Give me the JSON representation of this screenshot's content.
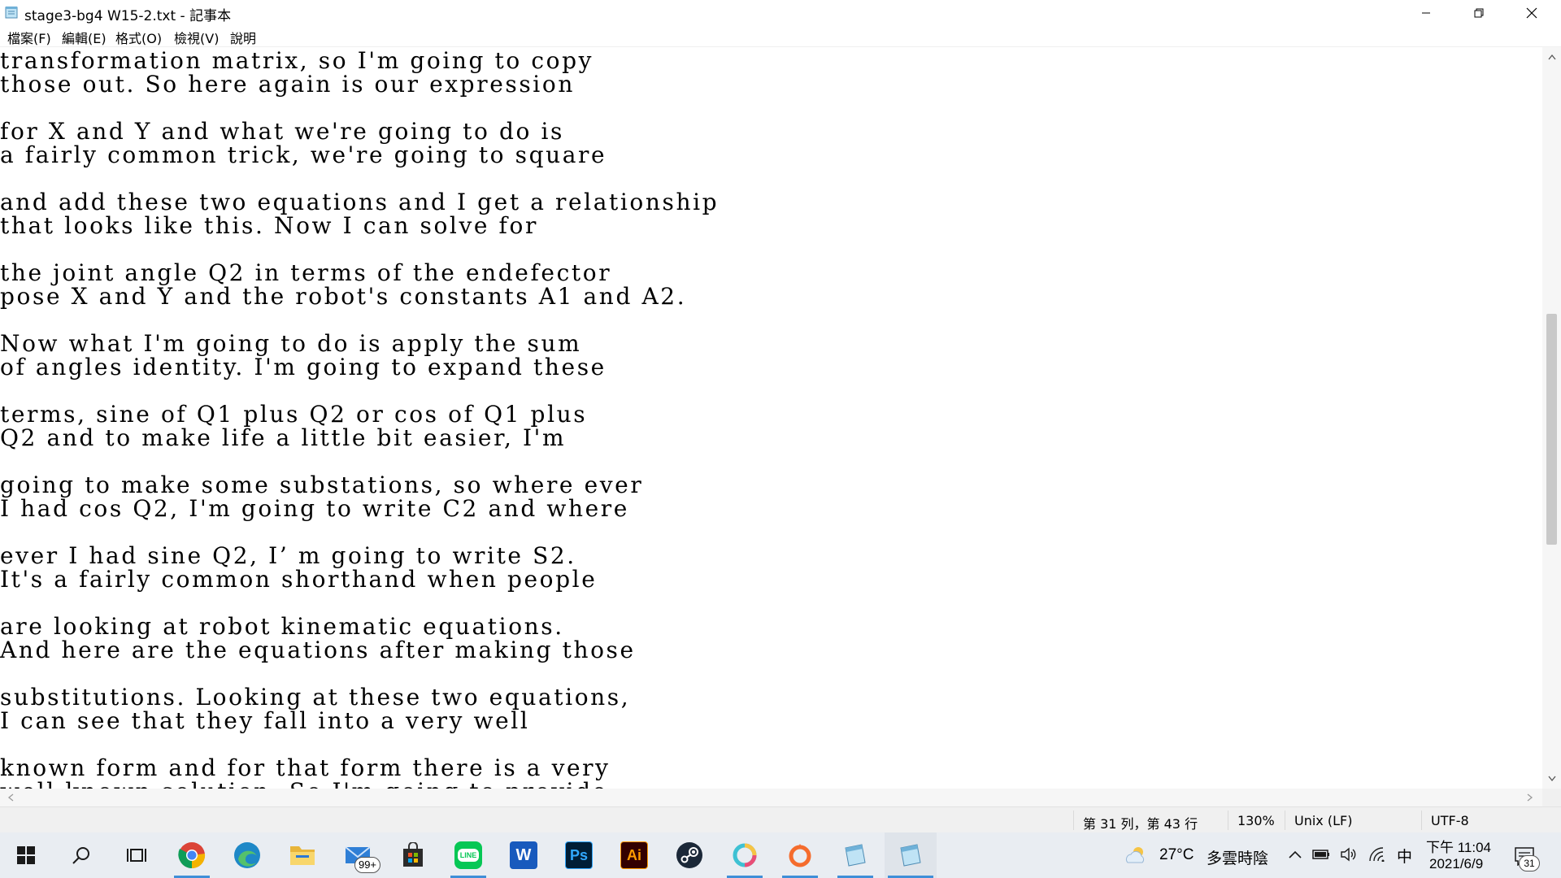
{
  "window": {
    "title": "stage3-bg4 W15-2.txt - 記事本"
  },
  "menu": {
    "items": [
      "檔案(F)",
      "編輯(E)",
      "格式(O)",
      "檢視(V)",
      "說明"
    ]
  },
  "editor": {
    "text": "transformation matrix, so I'm going to copy\nthose out. So here again is our expression\n\nfor X and Y and what we're going to do is\na fairly common trick, we're going to square\n\nand add these two equations and I get a relationship\nthat looks like this. Now I can solve for\n\nthe joint angle Q2 in terms of the endefector\npose X and Y and the robot's constants A1 and A2.\n\nNow what I'm going to do is apply the sum\nof angles identity. I'm going to expand these\n\nterms, sine of Q1 plus Q2 or cos of Q1 plus\nQ2 and to make life a little bit easier, I'm\n\ngoing to make some substations, so where ever\nI had cos Q2, I'm going to write C2 and where\n\never I had sine Q2, I’ m going to write S2.\nIt's a fairly common shorthand when people\n\nare looking at robot kinematic equations.\nAnd here are the equations after making those\n\nsubstitutions. Looking at these two equations,\nI can see that they fall into a very well\n\nknown form and for that form there is a very\nwell known solution. So I'm going to provide"
  },
  "statusbar": {
    "position": "第 31 列，第 43 行",
    "zoom": "130%",
    "line_ending": "Unix (LF)",
    "encoding": "UTF-8"
  },
  "taskbar": {
    "apps": [
      {
        "name": "start",
        "icon": "windows-icon"
      },
      {
        "name": "search",
        "icon": "search-icon"
      },
      {
        "name": "task-view",
        "icon": "task-view-icon"
      },
      {
        "name": "chrome",
        "icon": "chrome-icon",
        "running": true
      },
      {
        "name": "edge",
        "icon": "edge-icon"
      },
      {
        "name": "file-explorer",
        "icon": "folder-icon"
      },
      {
        "name": "mail",
        "icon": "mail-icon",
        "badge": "99+"
      },
      {
        "name": "store",
        "icon": "store-icon"
      },
      {
        "name": "line",
        "icon": "line-icon",
        "label": "LINE",
        "running": true
      },
      {
        "name": "word",
        "icon": "word-icon",
        "label": "W"
      },
      {
        "name": "photoshop",
        "icon": "photoshop-icon",
        "label": "Ps"
      },
      {
        "name": "illustrator",
        "icon": "illustrator-icon",
        "label": "Ai"
      },
      {
        "name": "steam",
        "icon": "steam-icon"
      },
      {
        "name": "app-ring",
        "icon": "ring-app-icon",
        "running": true
      },
      {
        "name": "origin",
        "icon": "origin-icon",
        "running": true
      },
      {
        "name": "notepad",
        "icon": "notepad-icon",
        "running": true
      },
      {
        "name": "notepad-active",
        "icon": "notepad-icon",
        "active": true
      }
    ],
    "weather": {
      "temperature": "27°C",
      "condition": "多雲時陰"
    },
    "ime": "中",
    "clock": {
      "time": "下午 11:04",
      "date": "2021/6/9"
    },
    "notifications": "31"
  },
  "colors": {
    "accent": "#3f8fd8",
    "taskbar_bg": "#e9edf2",
    "statusbar_bg": "#f0f0f0",
    "line_green": "#06c755",
    "word_blue": "#185abd",
    "photoshop_bg": "#001e36",
    "photoshop_fg": "#31a8ff",
    "illustrator_bg": "#330000",
    "illustrator_fg": "#ff9a00",
    "origin_orange": "#f56c2d"
  }
}
